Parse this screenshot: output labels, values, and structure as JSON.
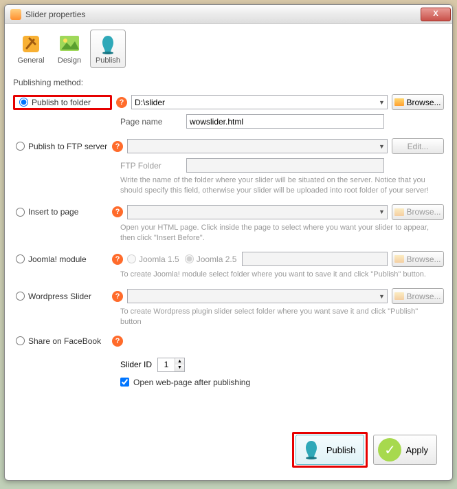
{
  "window": {
    "title": "Slider properties"
  },
  "tabs": {
    "general": "General",
    "design": "Design",
    "publish": "Publish"
  },
  "section": {
    "publishing_method": "Publishing method:"
  },
  "methods": {
    "publish_folder": {
      "label": "Publish to folder",
      "path": "D:\\slider",
      "browse": "Browse...",
      "page_name_label": "Page name",
      "page_name_value": "wowslider.html"
    },
    "ftp": {
      "label": "Publish to FTP server",
      "edit": "Edit...",
      "folder_label": "FTP Folder",
      "helper": "Write the name of the folder where your slider will be situated on the server. Notice that you should specify this field, otherwise your slider will be uploaded into root folder of your server!"
    },
    "insert": {
      "label": "Insert to page",
      "browse": "Browse...",
      "helper": "Open your HTML page. Click inside the page to select where you want your slider to appear, then click \"Insert Before\"."
    },
    "joomla": {
      "label": "Joomla! module",
      "opt15": "Joomla 1.5",
      "opt25": "Joomla 2.5",
      "browse": "Browse...",
      "helper": "To create Joomla! module select folder where you want to save it and click \"Publish\" button."
    },
    "wordpress": {
      "label": "Wordpress Slider",
      "browse": "Browse...",
      "helper": "To create Wordpress plugin slider select folder where you want save it and click \"Publish\" button"
    },
    "facebook": {
      "label": "Share on FaceBook"
    }
  },
  "slider_id": {
    "label": "Slider ID",
    "value": "1"
  },
  "open_after": {
    "label": "Open web-page after publishing"
  },
  "buttons": {
    "publish": "Publish",
    "apply": "Apply"
  }
}
